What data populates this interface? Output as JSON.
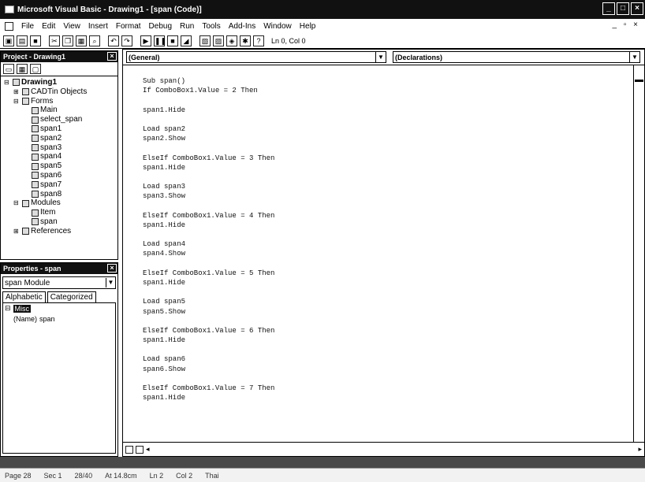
{
  "window": {
    "title": "Microsoft Visual Basic - Drawing1 - [span (Code)]"
  },
  "menu": [
    "File",
    "Edit",
    "View",
    "Insert",
    "Format",
    "Debug",
    "Run",
    "Tools",
    "Add-Ins",
    "Window",
    "Help"
  ],
  "toolbar": {
    "position": "Ln 0, Col 0"
  },
  "project": {
    "title": "Project - Drawing1",
    "tree": [
      {
        "label": "Drawing1",
        "level": 0,
        "exp": "⊟",
        "bold": true
      },
      {
        "label": "CADTin Objects",
        "level": 1,
        "exp": "⊞"
      },
      {
        "label": "Forms",
        "level": 1,
        "exp": "⊟"
      },
      {
        "label": "Main",
        "level": 2,
        "exp": ""
      },
      {
        "label": "select_span",
        "level": 2,
        "exp": ""
      },
      {
        "label": "span1",
        "level": 2,
        "exp": ""
      },
      {
        "label": "span2",
        "level": 2,
        "exp": ""
      },
      {
        "label": "span3",
        "level": 2,
        "exp": ""
      },
      {
        "label": "span4",
        "level": 2,
        "exp": ""
      },
      {
        "label": "span5",
        "level": 2,
        "exp": ""
      },
      {
        "label": "span6",
        "level": 2,
        "exp": ""
      },
      {
        "label": "span7",
        "level": 2,
        "exp": ""
      },
      {
        "label": "span8",
        "level": 2,
        "exp": ""
      },
      {
        "label": "Modules",
        "level": 1,
        "exp": "⊟"
      },
      {
        "label": "Item",
        "level": 2,
        "exp": ""
      },
      {
        "label": "span",
        "level": 2,
        "exp": ""
      },
      {
        "label": "References",
        "level": 1,
        "exp": "⊞"
      }
    ]
  },
  "properties": {
    "title": "Properties - span",
    "object": "span  Module",
    "tab_alpha": "Alphabetic",
    "tab_cat": "Categorized",
    "category": "Misc",
    "prop_name": "(Name)",
    "prop_value": "span"
  },
  "code": {
    "object_combo": "(General)",
    "proc_combo": "(Declarations)",
    "lines": [
      "Sub span()",
      "If ComboBox1.Value = 2 Then",
      "",
      "span1.Hide",
      "",
      "Load span2",
      "span2.Show",
      "",
      "ElseIf ComboBox1.Value = 3 Then",
      "span1.Hide",
      "",
      "Load span3",
      "span3.Show",
      "",
      "ElseIf ComboBox1.Value = 4 Then",
      "span1.Hide",
      "",
      "Load span4",
      "span4.Show",
      "",
      "ElseIf ComboBox1.Value = 5 Then",
      "span1.Hide",
      "",
      "Load span5",
      "span5.Show",
      "",
      "ElseIf ComboBox1.Value = 6 Then",
      "span1.Hide",
      "",
      "Load span6",
      "span6.Show",
      "",
      "ElseIf ComboBox1.Value = 7 Then",
      "span1.Hide"
    ]
  },
  "status": {
    "page": "Page 28",
    "sec": "Sec 1",
    "pages": "28/40",
    "at": "At 14.8cm",
    "ln": "Ln 2",
    "col": "Col 2",
    "lang": "Thai"
  }
}
